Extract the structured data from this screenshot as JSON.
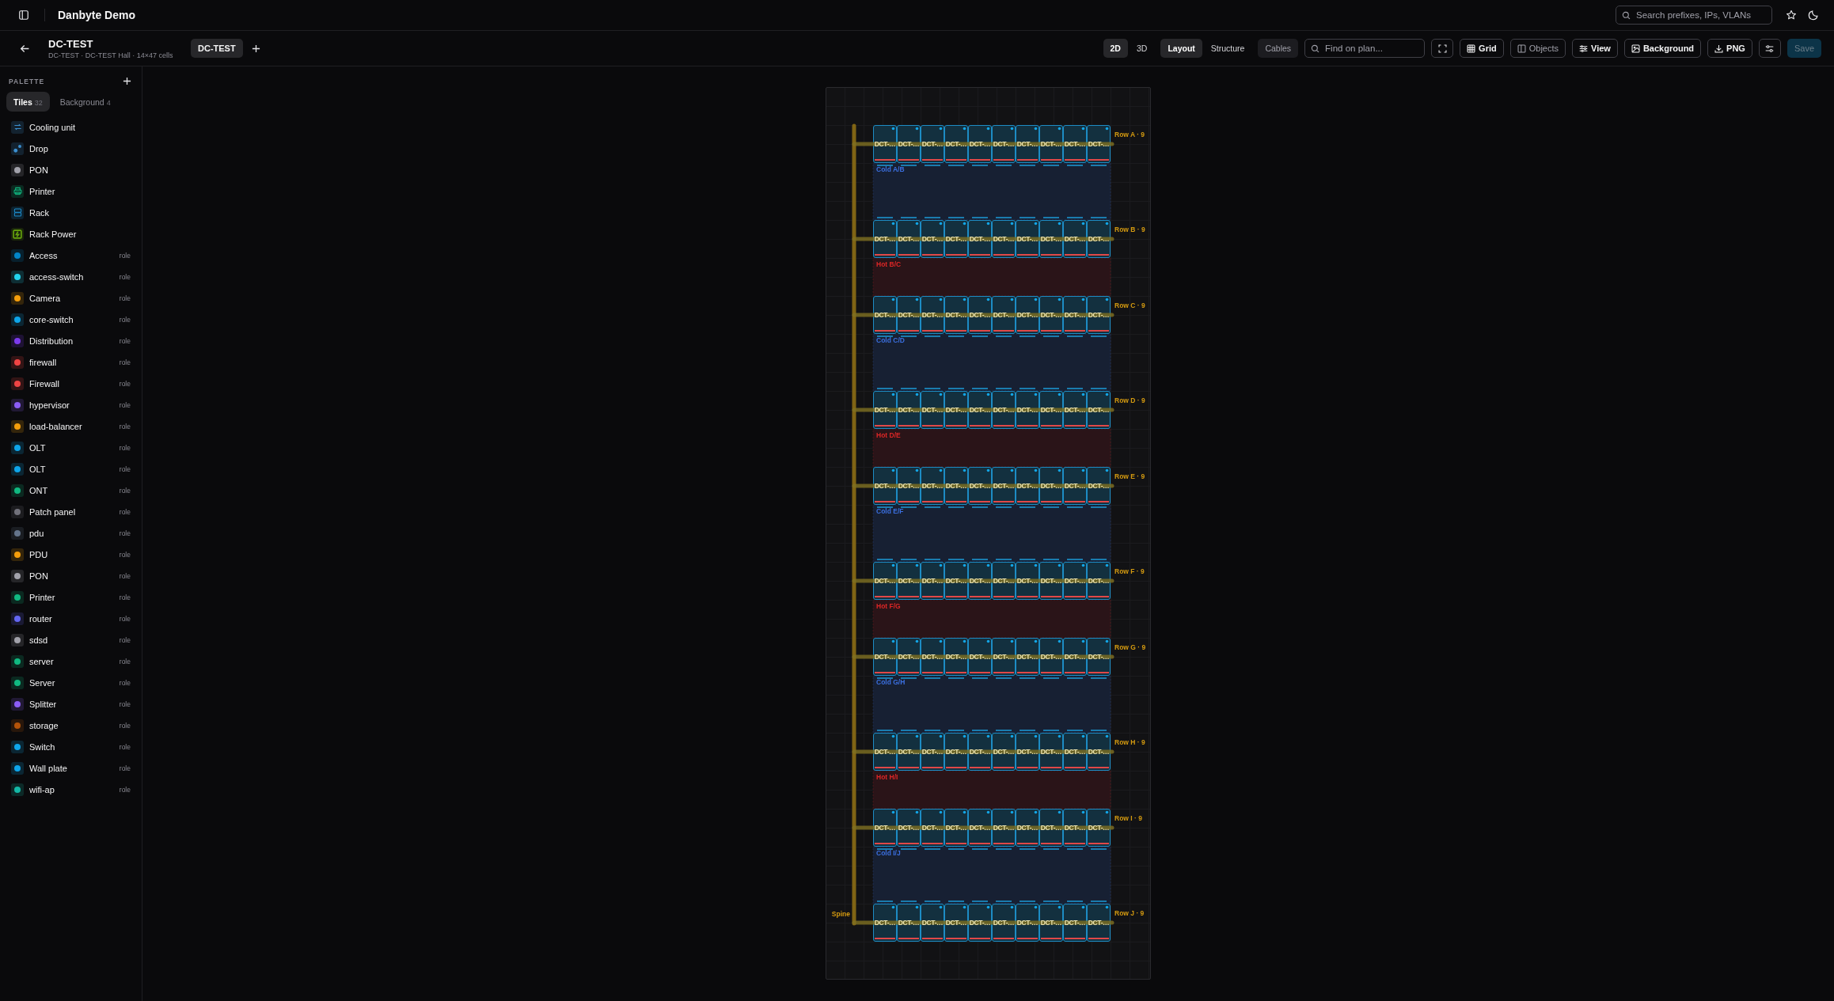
{
  "topbar": {
    "app_title": "Danbyte Demo",
    "search": {
      "placeholder": "Search prefixes, IPs, VLANs"
    }
  },
  "header": {
    "title": "DC-TEST",
    "subtitle": "DC-TEST · DC-TEST Hall · 14×47 cells",
    "tabs": [
      {
        "label": "DC-TEST",
        "selected": true
      }
    ]
  },
  "toolbar": {
    "dimension_tabs": [
      {
        "label": "2D",
        "selected": true
      },
      {
        "label": "3D",
        "selected": false
      }
    ],
    "mode_tabs": [
      {
        "label": "Layout",
        "selected": true
      },
      {
        "label": "Structure",
        "selected": false
      }
    ],
    "overlay_toggle": {
      "label": "Cables",
      "on": true
    },
    "find": {
      "placeholder": "Find on plan..."
    },
    "toggles": [
      {
        "label": "Grid",
        "kind": "grid",
        "on": true
      },
      {
        "label": "Objects",
        "kind": "panel",
        "on": false
      }
    ],
    "actions": [
      {
        "label": "View",
        "kind": "sliders"
      },
      {
        "label": "Background",
        "kind": "image"
      },
      {
        "label": "PNG",
        "kind": "download"
      }
    ],
    "save": {
      "label": "Save",
      "disabled": true
    }
  },
  "palette": {
    "title": "PALETTE",
    "tabs": [
      {
        "label": "Tiles",
        "count": "32",
        "selected": true
      },
      {
        "label": "Background",
        "count": "4",
        "selected": false
      }
    ],
    "items": [
      {
        "label": "Cooling unit",
        "kind": "cooling",
        "color": "#3b8fd0"
      },
      {
        "label": "Drop",
        "kind": "drop",
        "color": "#3b8fd0"
      },
      {
        "label": "PON",
        "kind": "dot",
        "color": "#a1a1aa"
      },
      {
        "label": "Printer",
        "kind": "printer",
        "color": "#10b981"
      },
      {
        "label": "Rack",
        "kind": "rack",
        "color": "#1d8fd0"
      },
      {
        "label": "Rack Power",
        "kind": "power",
        "color": "#65a30d"
      },
      {
        "label": "Access",
        "kind": "role",
        "tag": "role",
        "color": "#0284c7"
      },
      {
        "label": "access-switch",
        "kind": "role",
        "tag": "role",
        "color": "#22d3ee"
      },
      {
        "label": "Camera",
        "kind": "role",
        "tag": "role",
        "color": "#f59e0b"
      },
      {
        "label": "core-switch",
        "kind": "role",
        "tag": "role",
        "color": "#0ea5e9"
      },
      {
        "label": "Distribution",
        "kind": "role",
        "tag": "role",
        "color": "#7c3aed"
      },
      {
        "label": "firewall",
        "kind": "role",
        "tag": "role",
        "color": "#ef4444"
      },
      {
        "label": "Firewall",
        "kind": "role",
        "tag": "role",
        "color": "#ef4444"
      },
      {
        "label": "hypervisor",
        "kind": "role",
        "tag": "role",
        "color": "#8b5cf6"
      },
      {
        "label": "load-balancer",
        "kind": "role",
        "tag": "role",
        "color": "#f59e0b"
      },
      {
        "label": "OLT",
        "kind": "role",
        "tag": "role",
        "color": "#0ea5e9"
      },
      {
        "label": "OLT",
        "kind": "role",
        "tag": "role",
        "color": "#0ea5e9"
      },
      {
        "label": "ONT",
        "kind": "role",
        "tag": "role",
        "color": "#10b981"
      },
      {
        "label": "Patch panel",
        "kind": "role",
        "tag": "role",
        "color": "#71717a"
      },
      {
        "label": "pdu",
        "kind": "role",
        "tag": "role",
        "color": "#64748b"
      },
      {
        "label": "PDU",
        "kind": "role",
        "tag": "role",
        "color": "#f59e0b"
      },
      {
        "label": "PON",
        "kind": "role",
        "tag": "role",
        "color": "#a1a1aa"
      },
      {
        "label": "Printer",
        "kind": "role",
        "tag": "role",
        "color": "#10b981"
      },
      {
        "label": "router",
        "kind": "role",
        "tag": "role",
        "color": "#6366f1"
      },
      {
        "label": "sdsd",
        "kind": "role",
        "tag": "role",
        "color": "#a1a1aa"
      },
      {
        "label": "server",
        "kind": "role",
        "tag": "role",
        "color": "#10b981"
      },
      {
        "label": "Server",
        "kind": "role",
        "tag": "role",
        "color": "#10b981"
      },
      {
        "label": "Splitter",
        "kind": "role",
        "tag": "role",
        "color": "#8b5cf6"
      },
      {
        "label": "storage",
        "kind": "role",
        "tag": "role",
        "color": "#b45309"
      },
      {
        "label": "Switch",
        "kind": "role",
        "tag": "role",
        "color": "#0ea5e9"
      },
      {
        "label": "Wall plate",
        "kind": "role",
        "tag": "role",
        "color": "#0ea5e9"
      },
      {
        "label": "wifi-ap",
        "kind": "role",
        "tag": "role",
        "color": "#14b8a6"
      }
    ]
  },
  "plan": {
    "spine_label": "Spine",
    "rows": [
      {
        "label": "Row A · 9",
        "racks": [
          "DCT-…",
          "DCT-…",
          "DCT-…",
          "DCT-…",
          "DCT-…",
          "DCT-…",
          "DCT-…",
          "DCT-…",
          "DCT-…",
          "DCT-…"
        ]
      },
      {
        "label": "Row B · 9",
        "racks": [
          "DCT-…",
          "DCT-…",
          "DCT-…",
          "DCT-…",
          "DCT-…",
          "DCT-…",
          "DCT-…",
          "DCT-…",
          "DCT-…",
          "DCT-…"
        ]
      },
      {
        "label": "Row C · 9",
        "racks": [
          "DCT-…",
          "DCT-…",
          "DCT-…",
          "DCT-…",
          "DCT-…",
          "DCT-…",
          "DCT-…",
          "DCT-…",
          "DCT-…",
          "DCT-…"
        ]
      },
      {
        "label": "Row D · 9",
        "racks": [
          "DCT-…",
          "DCT-…",
          "DCT-…",
          "DCT-…",
          "DCT-…",
          "DCT-…",
          "DCT-…",
          "DCT-…",
          "DCT-…",
          "DCT-…"
        ]
      },
      {
        "label": "Row E · 9",
        "racks": [
          "DCT-…",
          "DCT-…",
          "DCT-…",
          "DCT-…",
          "DCT-…",
          "DCT-…",
          "DCT-…",
          "DCT-…",
          "DCT-…",
          "DCT-…"
        ]
      },
      {
        "label": "Row F · 9",
        "racks": [
          "DCT-…",
          "DCT-…",
          "DCT-…",
          "DCT-…",
          "DCT-…",
          "DCT-…",
          "DCT-…",
          "DCT-…",
          "DCT-…",
          "DCT-…"
        ]
      },
      {
        "label": "Row G · 9",
        "racks": [
          "DCT-…",
          "DCT-…",
          "DCT-…",
          "DCT-…",
          "DCT-…",
          "DCT-…",
          "DCT-…",
          "DCT-…",
          "DCT-…",
          "DCT-…"
        ]
      },
      {
        "label": "Row H · 9",
        "racks": [
          "DCT-…",
          "DCT-…",
          "DCT-…",
          "DCT-…",
          "DCT-…",
          "DCT-…",
          "DCT-…",
          "DCT-…",
          "DCT-…",
          "DCT-…"
        ]
      },
      {
        "label": "Row I · 9",
        "racks": [
          "DCT-…",
          "DCT-…",
          "DCT-…",
          "DCT-…",
          "DCT-…",
          "DCT-…",
          "DCT-…",
          "DCT-…",
          "DCT-…",
          "DCT-…"
        ]
      },
      {
        "label": "Row J · 9",
        "racks": [
          "DCT-…",
          "DCT-…",
          "DCT-…",
          "DCT-…",
          "DCT-…",
          "DCT-…",
          "DCT-…",
          "DCT-…",
          "DCT-…",
          "DCT-…"
        ]
      }
    ],
    "aisles": [
      {
        "label": "Cold A/B",
        "kind": "cold"
      },
      {
        "label": "Hot B/C",
        "kind": "hot"
      },
      {
        "label": "Cold C/D",
        "kind": "cold"
      },
      {
        "label": "Hot D/E",
        "kind": "hot"
      },
      {
        "label": "Cold E/F",
        "kind": "cold"
      },
      {
        "label": "Hot F/G",
        "kind": "hot"
      },
      {
        "label": "Cold G/H",
        "kind": "cold"
      },
      {
        "label": "Hot H/I",
        "kind": "hot"
      },
      {
        "label": "Cold I/J",
        "kind": "cold"
      }
    ]
  }
}
